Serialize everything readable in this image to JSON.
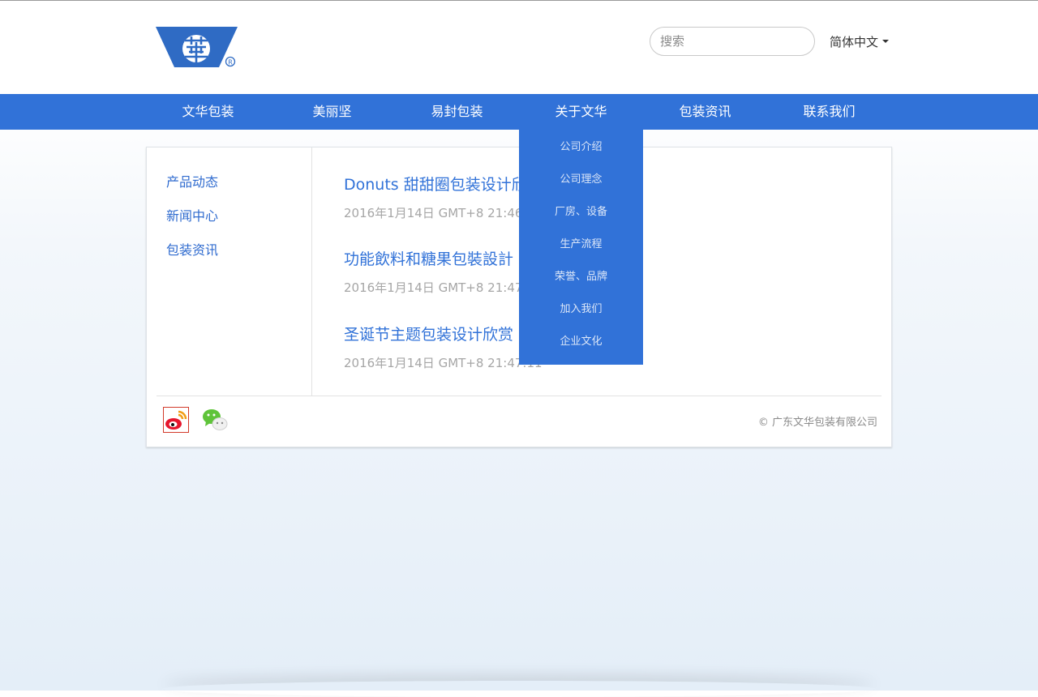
{
  "header": {
    "search_placeholder": "搜索",
    "language": "简体中文"
  },
  "nav": {
    "items": [
      {
        "label": "文华包装"
      },
      {
        "label": "美丽坚"
      },
      {
        "label": "易封包装"
      },
      {
        "label": "关于文华"
      },
      {
        "label": "包装资讯"
      },
      {
        "label": "联系我们"
      }
    ],
    "dropdown": [
      {
        "label": "公司介绍"
      },
      {
        "label": "公司理念"
      },
      {
        "label": "厂房、设备"
      },
      {
        "label": "生产流程"
      },
      {
        "label": "荣誉、品牌"
      },
      {
        "label": "加入我们"
      },
      {
        "label": "企业文化"
      }
    ]
  },
  "sidebar": {
    "links": [
      {
        "label": "产品动态"
      },
      {
        "label": "新闻中心"
      },
      {
        "label": "包装资讯"
      }
    ]
  },
  "articles": [
    {
      "title": "Donuts 甜甜圈包装设计欣赏",
      "date": "2016年1月14日 GMT+8 21:46:44"
    },
    {
      "title": "功能飲料和糖果包裝設計",
      "date": "2016年1月14日 GMT+8 21:47:11"
    },
    {
      "title": "圣诞节主题包装设计欣赏",
      "date": "2016年1月14日 GMT+8 21:47:11"
    }
  ],
  "footer": {
    "copyright": "© 广东文华包装有限公司",
    "social_icons": [
      "weibo-icon",
      "wechat-icon"
    ]
  },
  "colors": {
    "brand_blue": "#3172d8",
    "link_blue": "#2f6bcf",
    "date_gray": "#a6a6a6"
  }
}
